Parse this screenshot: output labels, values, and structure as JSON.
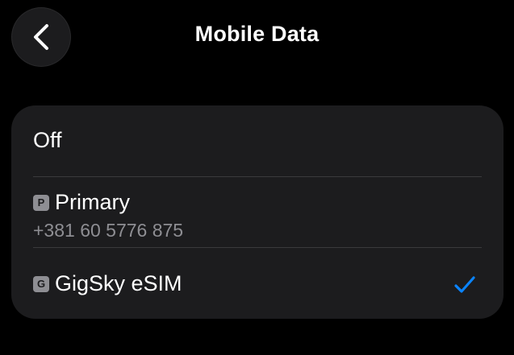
{
  "header": {
    "title": "Mobile Data",
    "back_icon": "chevron-left-icon"
  },
  "options": {
    "off_label": "Off",
    "primary": {
      "badge": "P",
      "name": "Primary",
      "number": "+381 60 5776 875"
    },
    "gigsky": {
      "badge": "G",
      "name": "GigSky eSIM",
      "selected": true
    }
  },
  "colors": {
    "background": "#000000",
    "card": "#1c1c1e",
    "separator": "#3a3a3c",
    "secondary_text": "#8e8e93",
    "accent": "#0a84ff"
  }
}
